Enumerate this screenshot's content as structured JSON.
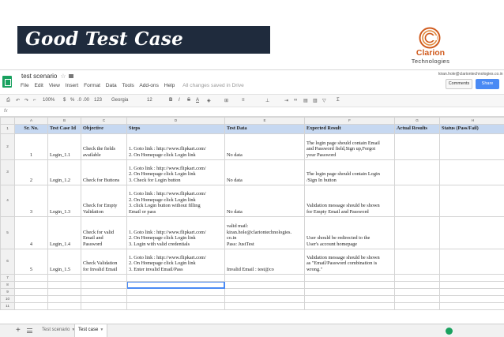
{
  "slide": {
    "title": "Good Test Case",
    "logo_name": "Clarion",
    "logo_sub": "Technologies",
    "accent_color": "#d05a1c"
  },
  "sheet": {
    "doc_title": "test scenario",
    "star_icon": "star-icon",
    "folder_icon": "folder-icon",
    "menu": [
      "File",
      "Edit",
      "View",
      "Insert",
      "Format",
      "Data",
      "Tools",
      "Add-ons",
      "Help"
    ],
    "saved_status": "All changes saved in Drive",
    "account": "kiran.hole@clariontechnologies.co.in",
    "comments_label": "Comments",
    "share_label": "Share",
    "formula_prefix": "fx",
    "toolbar": {
      "zoom": "100%",
      "currency": "$",
      "percent": "%",
      "decimals": ".0 .00",
      "number_format": "123",
      "font": "Georgia",
      "font_size": "12",
      "bold": "B",
      "italic": "I",
      "strike": "S",
      "text_color": "A",
      "sum": "Σ"
    },
    "columns": [
      "A",
      "B",
      "C",
      "D",
      "E",
      "F",
      "G",
      "H"
    ],
    "row_numbers": [
      "1",
      "2",
      "3",
      "4",
      "5",
      "6",
      "7",
      "8",
      "9",
      "10",
      "11"
    ],
    "headers": [
      "Sr. No.",
      "Test Case Id",
      "Objective",
      "Steps",
      "Test Data",
      "Expected Result",
      "Actual Results",
      "Status (Pass/Fail)"
    ],
    "rows": [
      {
        "sr": "1",
        "id": "Login_1.1",
        "objective": [
          "Check the fields",
          "available"
        ],
        "steps": [
          "1. Goto link : http://www.flipkart.com/",
          "2. On Homepage click Login link"
        ],
        "data": [
          "No data"
        ],
        "expected": [
          "The login page should contain Email",
          "and Password field,Sign up,Forgot",
          "your Password"
        ]
      },
      {
        "sr": "2",
        "id": "Login_1.2",
        "objective": [
          "Check for Buttons"
        ],
        "steps": [
          "1. Goto link : http://www.flipkart.com/",
          "2. On Homepage click Login link",
          "3. Check for Login button"
        ],
        "data": [
          "No data"
        ],
        "expected": [
          "The login page should contain Login",
          "/Sign In button"
        ]
      },
      {
        "sr": "3",
        "id": "Login_1.3",
        "objective": [
          "Check for Empty",
          "Validation"
        ],
        "steps": [
          "1. Goto link : http://www.flipkart.com/",
          "2. On Homepage click Login link",
          "3. click Login button without filling",
          "Email or pass"
        ],
        "data": [
          "No data"
        ],
        "expected": [
          "Validation message should be shown",
          "for Empty Email and Password"
        ]
      },
      {
        "sr": "4",
        "id": "Login_1.4",
        "objective": [
          "Check  for valid",
          "Email and",
          "Password"
        ],
        "steps": [
          "1. Goto link : http://www.flipkart.com/",
          "2. On Homepage click Login link",
          "3. Login with valid credentials"
        ],
        "data": [
          "valid mail:",
          "kiran.hole@clariontechnologies.",
          "co.in",
          "Pass: JustTest"
        ],
        "expected": [
          "User should be redirected to the",
          "User's account homepage"
        ]
      },
      {
        "sr": "5",
        "id": "Login_1.5",
        "objective": [
          "Check Validation",
          "for Invalid Email"
        ],
        "steps": [
          "1. Goto link : http://www.flipkart.com/",
          "2. On Homepage click Login link",
          "3. Enter invalid Email/Pass"
        ],
        "data": [
          "Invalid Email : test@co"
        ],
        "expected": [
          "Validation message should be shown",
          "as \"Email/Password combination is",
          "wrong.\""
        ]
      }
    ],
    "tabs": [
      {
        "label": "Test scenario"
      },
      {
        "label": "Test case"
      }
    ]
  }
}
